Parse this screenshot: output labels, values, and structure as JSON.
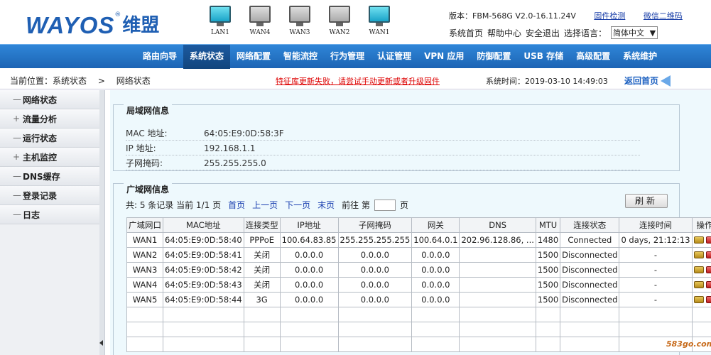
{
  "header": {
    "logo_text": "WAYOS",
    "logo_reg": "®",
    "logo_cn": "维盟",
    "version": "版本：FBM-568G V2.0-16.11.24V",
    "firmware_check": "固件检测",
    "wechat_qr": "微信二维码",
    "links": [
      "系统首页",
      "帮助中心",
      "安全退出",
      "选择语言："
    ],
    "language": "简体中文",
    "language_arrow": "▼"
  },
  "ports": [
    {
      "label": "LAN1",
      "active": true
    },
    {
      "label": "WAN4",
      "active": false
    },
    {
      "label": "WAN3",
      "active": false
    },
    {
      "label": "WAN2",
      "active": false
    },
    {
      "label": "WAN1",
      "active": true
    }
  ],
  "nav": {
    "items": [
      "路由向导",
      "系统状态",
      "网络配置",
      "智能流控",
      "行为管理",
      "认证管理",
      "VPN 应用",
      "防御配置",
      "USB 存储",
      "高级配置",
      "系统维护"
    ],
    "active_index": 1
  },
  "location": {
    "current": "当前位置：系统状态",
    "sep": ">",
    "page": "网络状态",
    "warning": "特征库更新失败，请尝试手动更新或者升级固件",
    "system_time": "系统时间：2019-03-10 14:49:03",
    "home": "返回首页"
  },
  "sidebar": {
    "items": [
      {
        "sign": "—",
        "label": "网络状态"
      },
      {
        "sign": "+",
        "label": "流量分析"
      },
      {
        "sign": "—",
        "label": "运行状态"
      },
      {
        "sign": "+",
        "label": "主机监控"
      },
      {
        "sign": "—",
        "label": "DNS缓存"
      },
      {
        "sign": "—",
        "label": "登录记录"
      },
      {
        "sign": "—",
        "label": "日志"
      }
    ]
  },
  "lan": {
    "title": "局域网信息",
    "rows": [
      {
        "key": "MAC 地址:",
        "value": "64:05:E9:0D:58:3F"
      },
      {
        "key": "IP 地址:",
        "value": "192.168.1.1"
      },
      {
        "key": "子网掩码:",
        "value": "255.255.255.0"
      }
    ]
  },
  "wan": {
    "title": "广域网信息",
    "pager": {
      "summary": "共: 5 条记录 当前 1/1 页",
      "first": "首页",
      "prev": "上一页",
      "next": "下一页",
      "last": "末页",
      "goto": "前往 第",
      "page_unit": "页"
    },
    "refresh": "刷新",
    "columns": [
      "广域网口",
      "MAC地址",
      "连接类型",
      "IP地址",
      "子网掩码",
      "网关",
      "DNS",
      "MTU",
      "连接状态",
      "连接时间",
      "操作"
    ],
    "rows": [
      [
        "WAN1",
        "64:05:E9:0D:58:40",
        "PPPoE",
        "100.64.83.85",
        "255.255.255.255",
        "100.64.0.1",
        "202.96.128.86, ...",
        "1480",
        "Connected",
        "0 days, 21:12:13"
      ],
      [
        "WAN2",
        "64:05:E9:0D:58:41",
        "关闭",
        "0.0.0.0",
        "0.0.0.0",
        "0.0.0.0",
        "",
        "1500",
        "Disconnected",
        "-"
      ],
      [
        "WAN3",
        "64:05:E9:0D:58:42",
        "关闭",
        "0.0.0.0",
        "0.0.0.0",
        "0.0.0.0",
        "",
        "1500",
        "Disconnected",
        "-"
      ],
      [
        "WAN4",
        "64:05:E9:0D:58:43",
        "关闭",
        "0.0.0.0",
        "0.0.0.0",
        "0.0.0.0",
        "",
        "1500",
        "Disconnected",
        "-"
      ],
      [
        "WAN5",
        "64:05:E9:0D:58:44",
        "3G",
        "0.0.0.0",
        "0.0.0.0",
        "0.0.0.0",
        "",
        "1500",
        "Disconnected",
        "-"
      ]
    ],
    "empty_rows": 3
  },
  "watermark": "583go.com",
  "colors": {
    "brand": "#1f5fb3",
    "nav": "#1c64b4",
    "warning": "#dd0000",
    "link": "#1a3fb0"
  }
}
